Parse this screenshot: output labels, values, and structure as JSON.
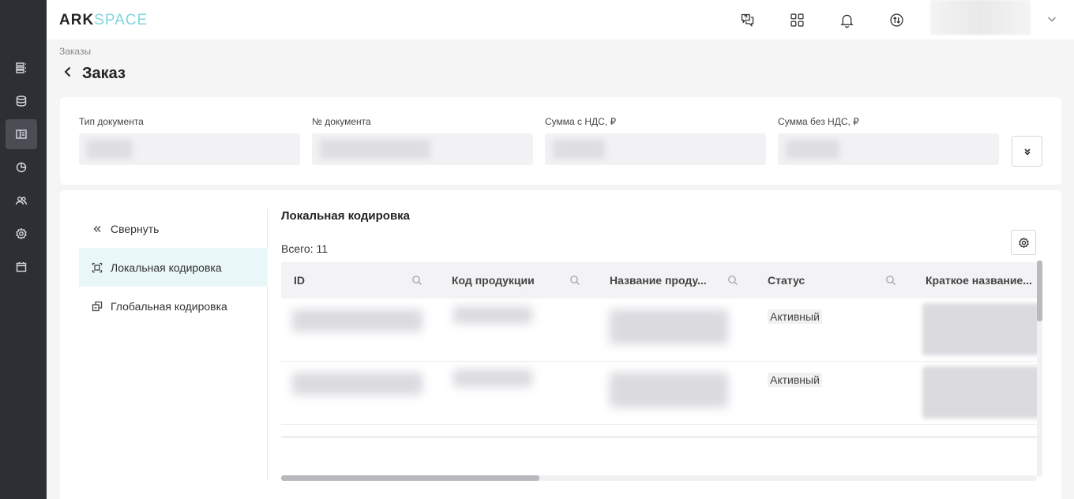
{
  "app": {
    "logo_ark": "ARK",
    "logo_space": "SPACE"
  },
  "sidebar": {
    "items": [
      {
        "icon": "list-icon"
      },
      {
        "icon": "database-icon"
      },
      {
        "icon": "layout-icon",
        "active": true
      },
      {
        "icon": "pie-chart-icon"
      },
      {
        "icon": "users-icon"
      },
      {
        "icon": "gear-icon"
      },
      {
        "icon": "calendar-icon"
      }
    ]
  },
  "topbar": {
    "icons": [
      "help-chat-icon",
      "apps-grid-icon",
      "bell-icon",
      "sync-icon",
      "chevron-down-icon"
    ]
  },
  "breadcrumb": "Заказы",
  "page_title": "Заказ",
  "fields": [
    {
      "label": "Тип документа"
    },
    {
      "label": "№ документа"
    },
    {
      "label": "Сумма с НДС, ₽"
    },
    {
      "label": "Сумма без НДС, ₽"
    }
  ],
  "side_menu": {
    "collapse": "Свернуть",
    "local": "Локальная кодировка",
    "global": "Глобальная кодировка"
  },
  "content": {
    "title": "Локальная кодировка",
    "total": "Всего: 11",
    "columns": [
      "ID",
      "Код продукции",
      "Название проду...",
      "Статус",
      "Краткое название..."
    ],
    "rows": [
      {
        "status": "Активный"
      },
      {
        "status": "Активный"
      }
    ]
  }
}
